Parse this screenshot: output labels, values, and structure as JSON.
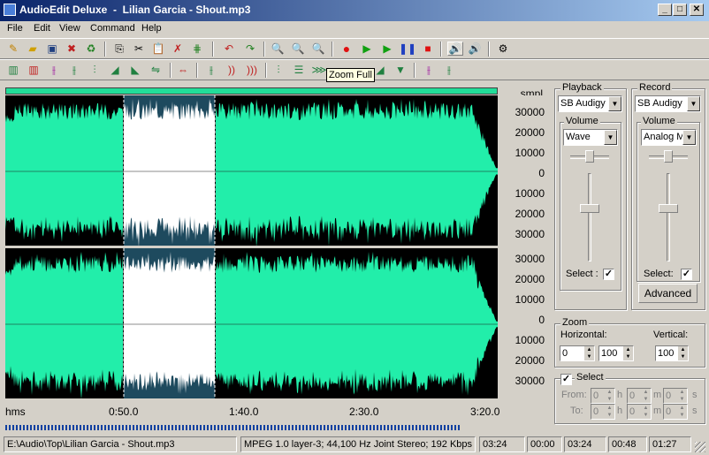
{
  "window": {
    "title": "AudioEdit Deluxe  -  Lilian Garcia - Shout.mp3",
    "min": "_",
    "max": "□",
    "close": "✕"
  },
  "menu": [
    "File",
    "Edit",
    "View",
    "Command",
    "Help"
  ],
  "tooltip": "Zoom Full",
  "scale": {
    "unit": "smpl",
    "labels": [
      "30000",
      "20000",
      "10000",
      "0",
      "10000",
      "20000",
      "30000"
    ]
  },
  "timeline": {
    "labels": [
      "hms",
      "0:50.0",
      "1:40.0",
      "2:30.0",
      "3:20.0"
    ]
  },
  "playback": {
    "label": "Playback",
    "device": "SB Audigy",
    "volume_label": "Volume",
    "volume_source": "Wave",
    "select_label": "Select :",
    "select_checked": true,
    "volume_level": 0.6
  },
  "record": {
    "label": "Record",
    "device": "SB Audigy",
    "volume_label": "Volume",
    "volume_source": "Analog M",
    "select_label": "Select:",
    "select_checked": true,
    "advanced_label": "Advanced",
    "volume_level": 0.6
  },
  "zoom": {
    "label": "Zoom",
    "horizontal_label": "Horizontal:",
    "vertical_label": "Vertical:",
    "h_from": "0",
    "h_to": "100",
    "vertical": "100"
  },
  "select": {
    "label": "Select",
    "checked": true,
    "from_label": "From:",
    "to_label": "To:",
    "units": [
      "h",
      "m",
      "s"
    ],
    "from": [
      "0",
      "0",
      "0"
    ],
    "to": [
      "0",
      "0",
      "0"
    ]
  },
  "status": {
    "path": "E:\\Audio\\Top\\Lilian Garcia - Shout.mp3",
    "format": "MPEG 1.0 layer-3; 44,100 Hz Joint Stereo;  192 Kbps",
    "length": "03:24",
    "sel_start": "00:00",
    "sel_end": "03:24",
    "sel_from": "00:48",
    "sel_to": "01:27"
  },
  "colors": {
    "wave": "#22eeaa",
    "selection_bg": "#1e4a5e",
    "titlebar": "#0a246a"
  },
  "selection": {
    "start_time": "0:48",
    "end_time": "1:27"
  }
}
